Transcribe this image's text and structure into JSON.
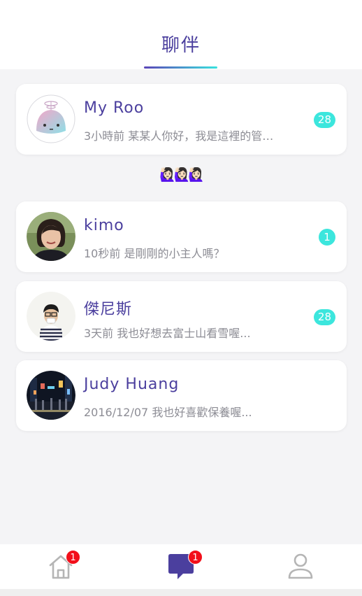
{
  "header": {
    "title": "聊伴"
  },
  "divider_emoji": "🙋🏻‍♀️🙋🏻‍♀️🙋🏻‍♀️",
  "chats": [
    {
      "name": "My Roo",
      "time": "3小時前",
      "message": "某某人你好，我是這裡的管…",
      "unread": "28",
      "avatar": "robot-avatar"
    },
    {
      "name": "kimo",
      "time": "10秒前",
      "message": "是剛剛的小主人嗎？",
      "unread": "1",
      "avatar": "woman-avatar"
    },
    {
      "name": "傑尼斯",
      "time": "3天前",
      "message": "我也好想去富士山看雪喔...",
      "unread": "28",
      "avatar": "boy-avatar"
    },
    {
      "name": "Judy Huang",
      "time": "2016/12/07",
      "message": "我也好喜歡保養喔...",
      "unread": "",
      "avatar": "city-night-avatar"
    }
  ],
  "tabbar": {
    "home_badge": "1",
    "chat_badge": "1"
  },
  "colors": {
    "accent": "#4b3f9e",
    "badge": "#3ce6dd",
    "notification": "#f20f1a",
    "icon_inactive": "#b5b5b5"
  }
}
